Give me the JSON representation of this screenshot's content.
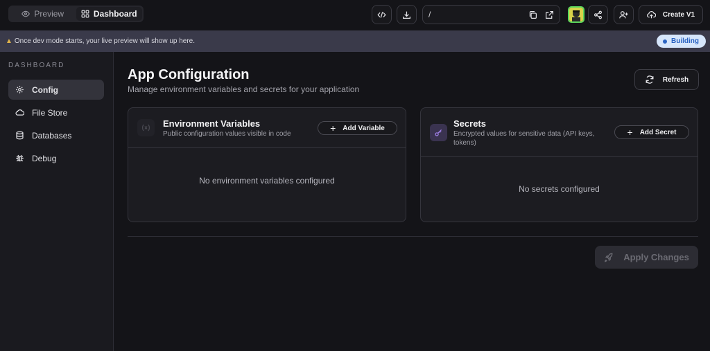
{
  "topbar": {
    "tabs": [
      {
        "label": "Preview",
        "icon": "eye-icon"
      },
      {
        "label": "Dashboard",
        "icon": "grid-icon"
      }
    ],
    "url": "/",
    "create_label": "Create V1"
  },
  "banner": {
    "message": "Once dev mode starts, your live preview will show up here.",
    "status": "Building"
  },
  "sidebar": {
    "title": "DASHBOARD",
    "items": [
      {
        "label": "Config",
        "icon": "gear-icon"
      },
      {
        "label": "File Store",
        "icon": "cloud-icon"
      },
      {
        "label": "Databases",
        "icon": "database-icon"
      },
      {
        "label": "Debug",
        "icon": "bug-icon"
      }
    ]
  },
  "main": {
    "title": "App Configuration",
    "subtitle": "Manage environment variables and secrets for your application",
    "refresh_label": "Refresh",
    "env_card": {
      "title": "Environment Variables",
      "description": "Public configuration values visible in code",
      "add_label": "Add Variable",
      "empty": "No environment variables configured"
    },
    "secrets_card": {
      "title": "Secrets",
      "description": "Encrypted values for sensitive data (API keys, tokens)",
      "add_label": "Add Secret",
      "empty": "No secrets configured"
    },
    "apply_label": "Apply Changes"
  },
  "colors": {
    "background": "#141418",
    "banner": "#3a3a4a",
    "badge_bg": "#d6e6fb",
    "badge_text": "#2a63c2",
    "secret_icon": "#8f6fd6"
  }
}
